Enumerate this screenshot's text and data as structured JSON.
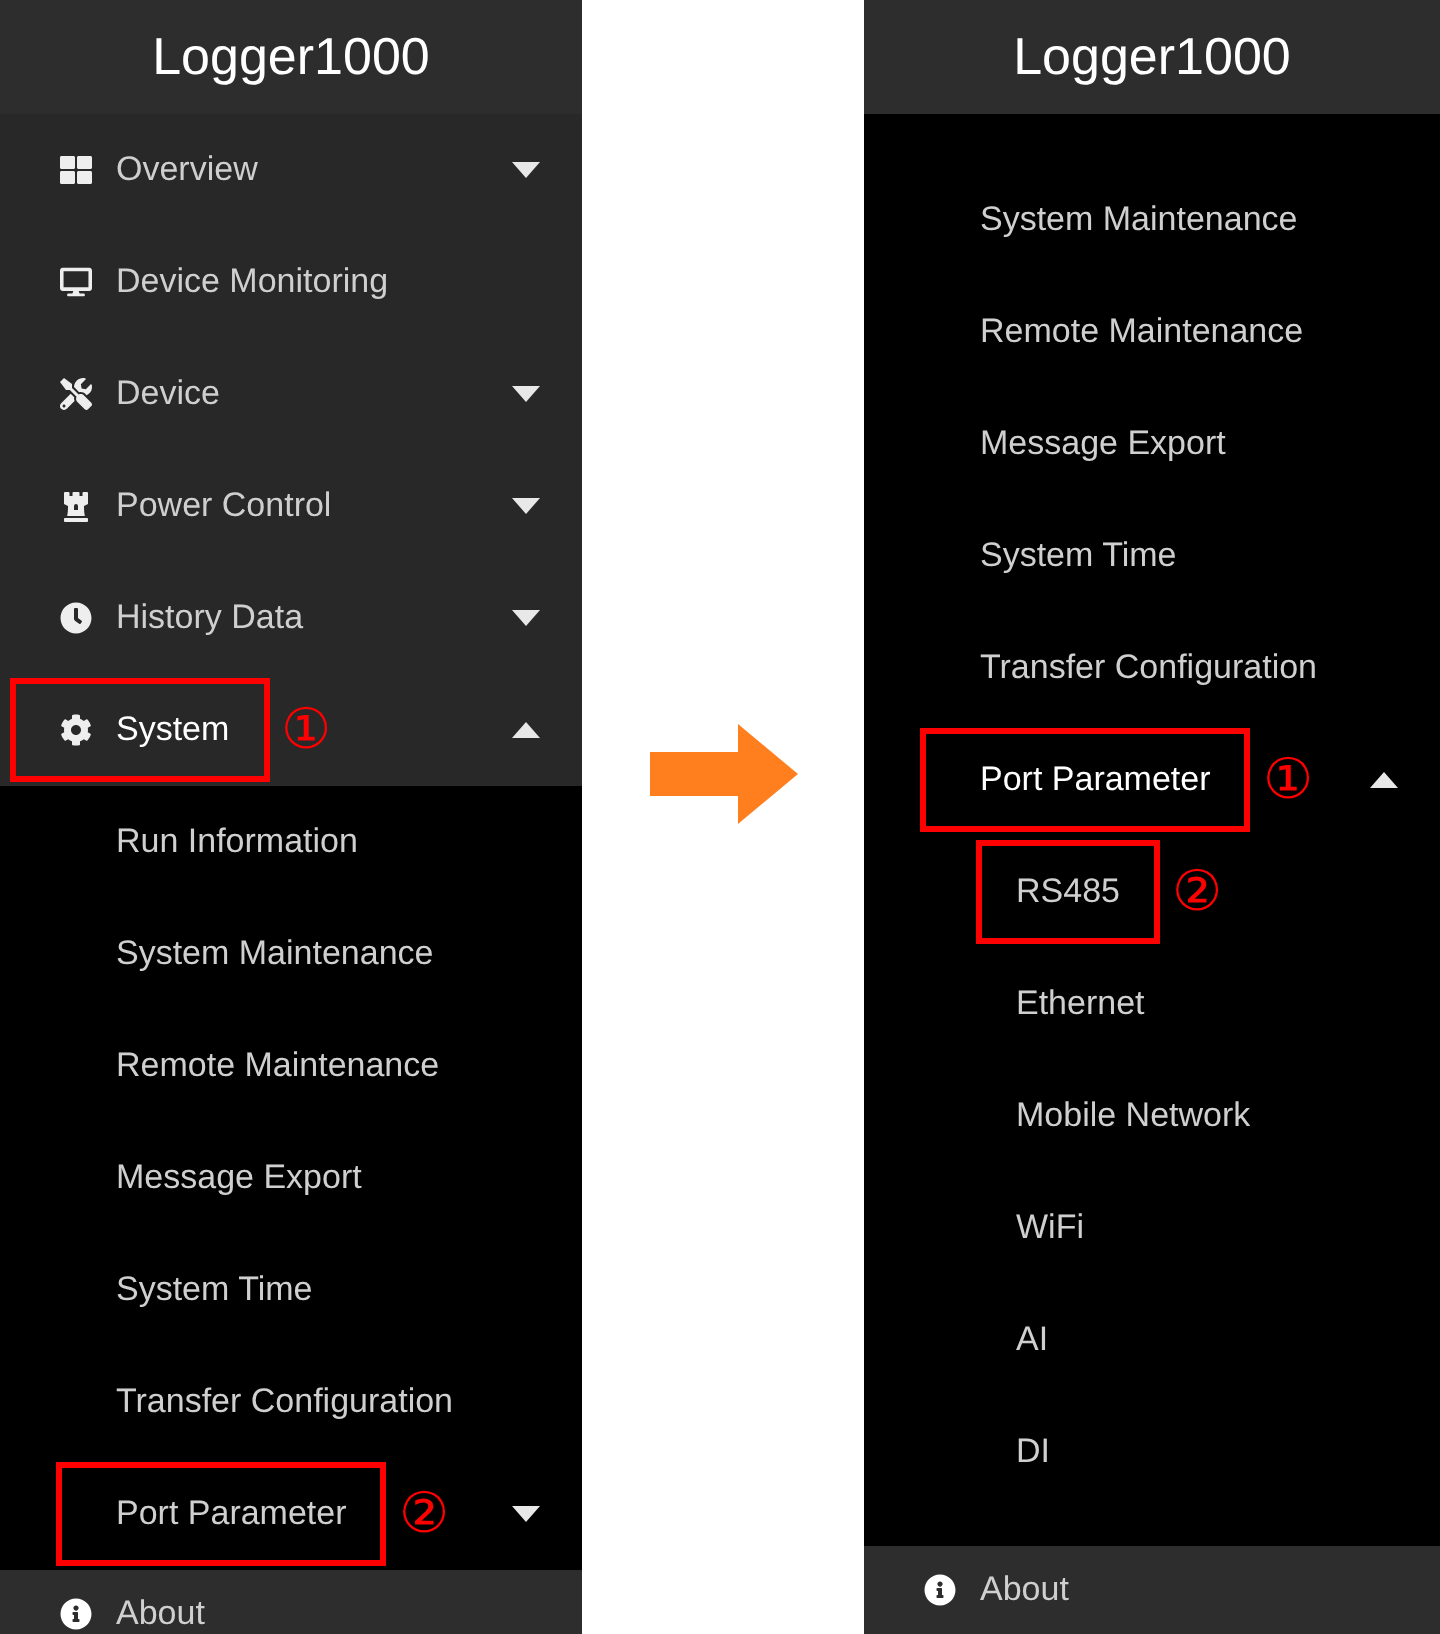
{
  "panels": [
    {
      "kind": "full",
      "title": "Logger1000",
      "menu": [
        {
          "kind": "group",
          "label": "Overview",
          "expanded": false,
          "highlighted": false
        },
        {
          "kind": "link",
          "label": "Device Monitoring",
          "highlighted": false
        },
        {
          "kind": "group",
          "label": "Device",
          "expanded": false,
          "highlighted": false
        },
        {
          "kind": "group",
          "label": "Power Control",
          "expanded": false,
          "highlighted": false
        },
        {
          "kind": "group",
          "label": "History Data",
          "expanded": false,
          "highlighted": false
        },
        {
          "kind": "group",
          "label": "System",
          "expanded": true,
          "highlighted": true,
          "callout": "①",
          "children": [
            {
              "kind": "link",
              "label": "Run Information",
              "highlighted": false
            },
            {
              "kind": "link",
              "label": "System Maintenance",
              "highlighted": false
            },
            {
              "kind": "link",
              "label": "Remote Maintenance",
              "highlighted": false
            },
            {
              "kind": "link",
              "label": "Message Export",
              "highlighted": false
            },
            {
              "kind": "link",
              "label": "System Time",
              "highlighted": false
            },
            {
              "kind": "link",
              "label": "Transfer Configuration",
              "highlighted": false
            },
            {
              "kind": "group",
              "label": "Port Parameter",
              "expanded": false,
              "highlighted": true,
              "callout": "②"
            }
          ]
        }
      ],
      "footer": {
        "label": "About"
      }
    },
    {
      "kind": "scrolled",
      "title": "Logger1000",
      "menu": [
        {
          "kind": "link",
          "label": "System Maintenance",
          "highlighted": false
        },
        {
          "kind": "link",
          "label": "Remote Maintenance",
          "highlighted": false
        },
        {
          "kind": "link",
          "label": "Message Export",
          "highlighted": false
        },
        {
          "kind": "link",
          "label": "System Time",
          "highlighted": false
        },
        {
          "kind": "link",
          "label": "Transfer Configuration",
          "highlighted": false
        },
        {
          "kind": "group",
          "label": "Port Parameter",
          "expanded": true,
          "highlighted": true,
          "callout": "①",
          "children": [
            {
              "kind": "link",
              "label": "RS485",
              "highlighted": true,
              "callout": "②"
            },
            {
              "kind": "link",
              "label": "Ethernet",
              "highlighted": false
            },
            {
              "kind": "link",
              "label": "Mobile Network",
              "highlighted": false
            },
            {
              "kind": "link",
              "label": "WiFi",
              "highlighted": false
            },
            {
              "kind": "link",
              "label": "AI",
              "highlighted": false
            },
            {
              "kind": "link",
              "label": "DI",
              "highlighted": false
            }
          ]
        }
      ],
      "footer": {
        "label": "About"
      }
    }
  ]
}
